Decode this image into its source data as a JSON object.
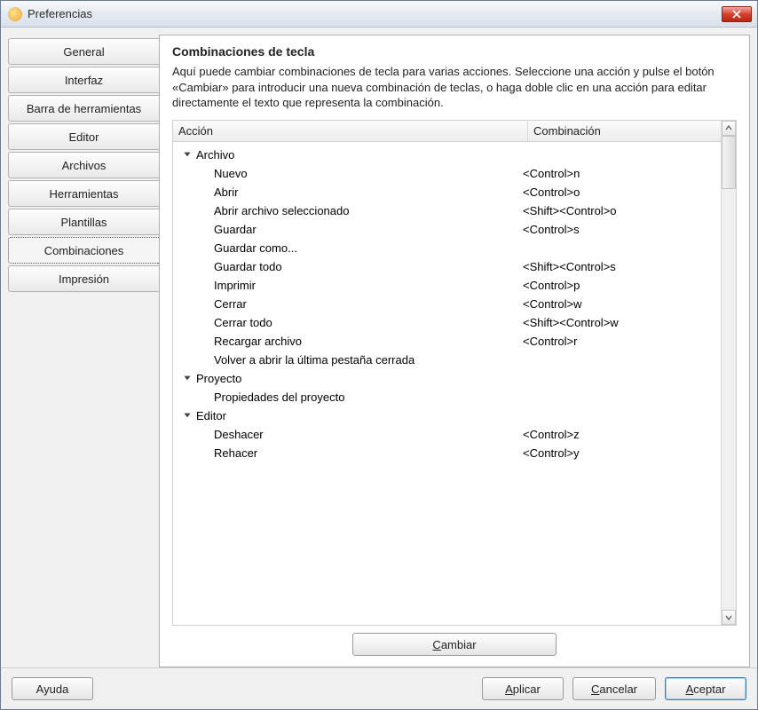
{
  "window": {
    "title": "Preferencias"
  },
  "sidebar": {
    "items": [
      {
        "label": "General"
      },
      {
        "label": "Interfaz"
      },
      {
        "label": "Barra de herramientas"
      },
      {
        "label": "Editor"
      },
      {
        "label": "Archivos"
      },
      {
        "label": "Herramientas"
      },
      {
        "label": "Plantillas"
      },
      {
        "label": "Combinaciones"
      },
      {
        "label": "Impresión"
      }
    ],
    "selected_index": 7
  },
  "panel": {
    "title": "Combinaciones de tecla",
    "description": "Aquí puede cambiar combinaciones de tecla para varias acciones. Seleccione una acción y pulse el botón «Cambiar» para introducir una nueva combinación de teclas, o haga doble clic en una acción para editar directamente el texto que representa la combinación.",
    "columns": {
      "action": "Acción",
      "combo": "Combinación"
    },
    "groups": [
      {
        "name": "Archivo",
        "items": [
          {
            "action": "Nuevo",
            "combo": "<Control>n"
          },
          {
            "action": "Abrir",
            "combo": "<Control>o"
          },
          {
            "action": "Abrir archivo seleccionado",
            "combo": "<Shift><Control>o"
          },
          {
            "action": "Guardar",
            "combo": "<Control>s"
          },
          {
            "action": "Guardar como...",
            "combo": ""
          },
          {
            "action": "Guardar todo",
            "combo": "<Shift><Control>s"
          },
          {
            "action": "Imprimir",
            "combo": "<Control>p"
          },
          {
            "action": "Cerrar",
            "combo": "<Control>w"
          },
          {
            "action": "Cerrar todo",
            "combo": "<Shift><Control>w"
          },
          {
            "action": "Recargar archivo",
            "combo": "<Control>r"
          },
          {
            "action": "Volver a abrir la última pestaña cerrada",
            "combo": ""
          }
        ]
      },
      {
        "name": "Proyecto",
        "items": [
          {
            "action": "Propiedades del proyecto",
            "combo": ""
          }
        ]
      },
      {
        "name": "Editor",
        "items": [
          {
            "action": "Deshacer",
            "combo": "<Control>z"
          },
          {
            "action": "Rehacer",
            "combo": "<Control>y"
          }
        ]
      }
    ],
    "change_button": "Cambiar",
    "change_mnemonic": "C"
  },
  "footer": {
    "help": "Ayuda",
    "apply": "Aplicar",
    "apply_mnemonic": "A",
    "cancel": "Cancelar",
    "cancel_mnemonic": "C",
    "accept": "Aceptar",
    "accept_mnemonic": "A"
  }
}
